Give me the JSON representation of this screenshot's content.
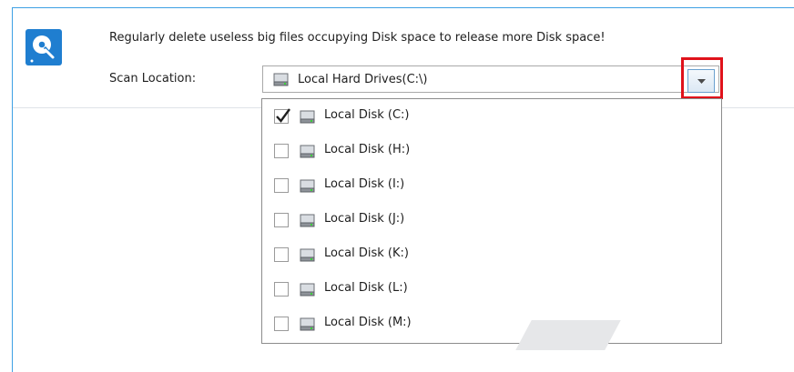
{
  "header": {
    "app_icon": "disk-cleanup-icon",
    "description": "Regularly delete useless big files occupying Disk space to release more Disk space!",
    "scan_location_label": "Scan Location:"
  },
  "scan_location": {
    "selected_value": "Local Hard Drives(C:\\)",
    "dropdown_icon": "chevron-down-icon",
    "options": [
      {
        "label": "Local Disk (C:)",
        "checked": true
      },
      {
        "label": "Local Disk (H:)",
        "checked": false
      },
      {
        "label": "Local Disk (I:)",
        "checked": false
      },
      {
        "label": "Local Disk (J:)",
        "checked": false
      },
      {
        "label": "Local Disk (K:)",
        "checked": false
      },
      {
        "label": "Local Disk (L:)",
        "checked": false
      },
      {
        "label": "Local Disk (M:)",
        "checked": false
      }
    ]
  },
  "colors": {
    "accent": "#1f7ed0",
    "window_border": "#3ea0e4",
    "highlight_box": "#e0121b"
  }
}
